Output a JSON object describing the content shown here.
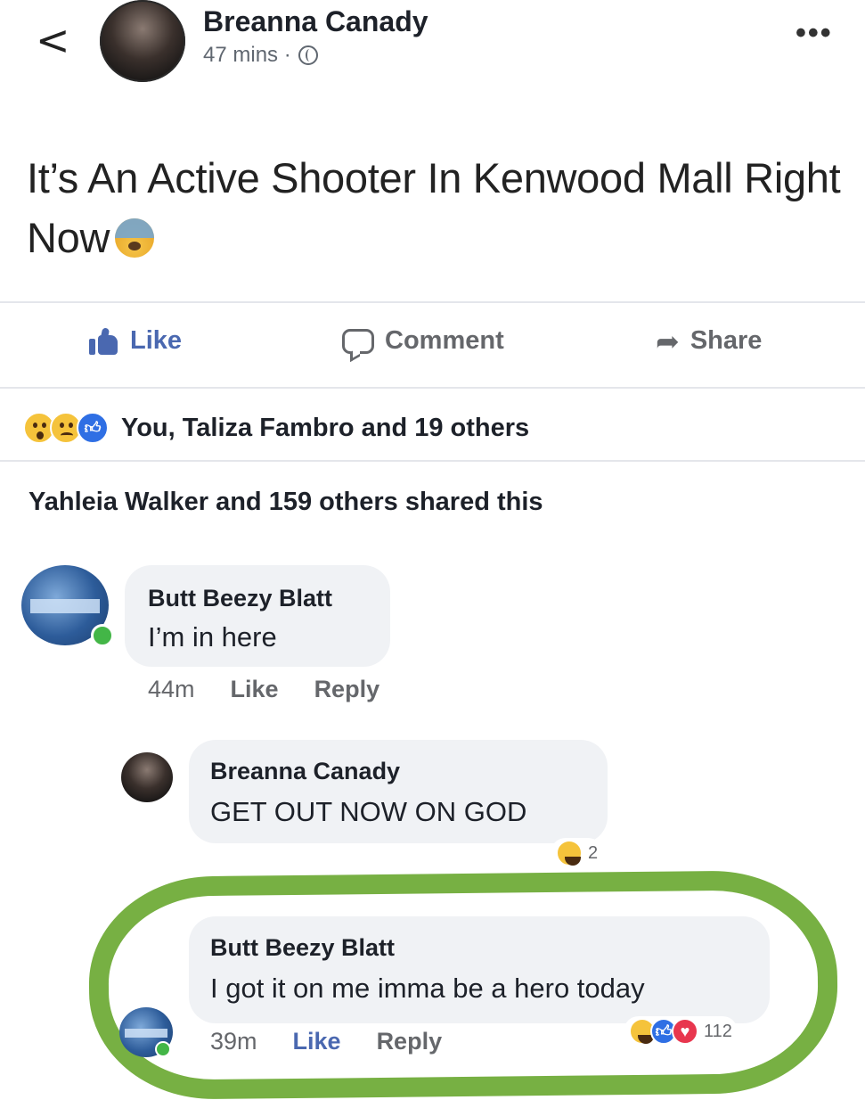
{
  "header": {
    "back_glyph": "<",
    "author": "Breanna Canady",
    "time": "47 mins ·",
    "privacy_icon": "globe-icon",
    "more_glyph": "•••"
  },
  "post": {
    "text": "It’s An Active Shooter In Kenwood Mall Right Now",
    "emoji": "anxious-face-with-sweat"
  },
  "actions": {
    "like": "Like",
    "comment": "Comment",
    "share": "Share"
  },
  "reactions": {
    "icons": [
      "wow",
      "sad",
      "like"
    ],
    "summary": "You, Taliza Fambro and 19 others"
  },
  "shares": "Yahleia Walker and 159 others shared this",
  "comments": [
    {
      "author": "Butt Beezy Blatt",
      "text": "I’m in here",
      "time": "44m",
      "like": "Like",
      "reply": "Reply"
    },
    {
      "author": "Breanna Canady",
      "text": "GET OUT NOW ON GOD",
      "reaction_icons": [
        "haha"
      ],
      "reaction_count": "2"
    },
    {
      "author": "Butt Beezy Blatt",
      "text": "I got it on me imma be a hero today",
      "time": "39m",
      "like": "Like",
      "reply": "Reply",
      "reaction_icons": [
        "haha",
        "like",
        "love"
      ],
      "reaction_count": "112"
    }
  ],
  "colors": {
    "like_blue": "#4a68b0",
    "highlight_green": "#77b043",
    "bubble_grey": "#f0f2f5",
    "secondary_text": "#65676b"
  }
}
